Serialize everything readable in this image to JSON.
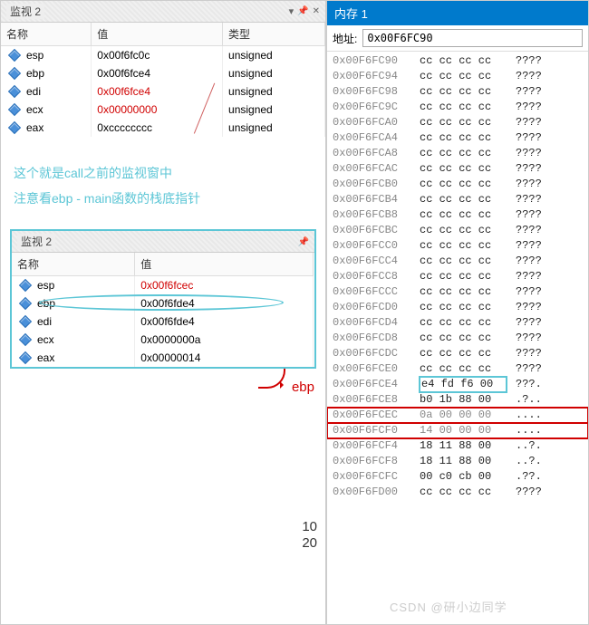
{
  "watch_top": {
    "title": "监视 2",
    "headers": {
      "name": "名称",
      "value": "值",
      "type": "类型"
    },
    "rows": [
      {
        "name": "esp",
        "value": "0x00f6fc0c",
        "type": "unsigned",
        "red": false
      },
      {
        "name": "ebp",
        "value": "0x00f6fce4",
        "type": "unsigned",
        "red": false
      },
      {
        "name": "edi",
        "value": "0x00f6fce4",
        "type": "unsigned",
        "red": true
      },
      {
        "name": "ecx",
        "value": "0x00000000",
        "type": "unsigned",
        "red": true
      },
      {
        "name": "eax",
        "value": "0xcccccccc",
        "type": "unsigned",
        "red": false
      }
    ]
  },
  "note": {
    "line1": "这个就是call之前的监视窗中",
    "line2": "注意看ebp - main函数的栈底指针"
  },
  "watch_sub": {
    "title": "监视 2",
    "headers": {
      "name": "名称",
      "value": "值"
    },
    "rows": [
      {
        "name": "esp",
        "value": "0x00f6fcec",
        "red": true
      },
      {
        "name": "ebp",
        "value": "0x00f6fde4",
        "red": false,
        "circled": true
      },
      {
        "name": "edi",
        "value": "0x00f6fde4",
        "red": false
      },
      {
        "name": "ecx",
        "value": "0x0000000a",
        "red": false
      },
      {
        "name": "eax",
        "value": "0x00000014",
        "red": false
      }
    ],
    "pointer_label": "ebp"
  },
  "annot": {
    "n1": "10",
    "n2": "20"
  },
  "memory": {
    "title": "内存 1",
    "addr_label": "地址:",
    "addr_value": "0x00F6FC90",
    "rows": [
      {
        "addr": "0x00F6FC90",
        "bytes": "cc cc cc cc",
        "ascii": "????"
      },
      {
        "addr": "0x00F6FC94",
        "bytes": "cc cc cc cc",
        "ascii": "????"
      },
      {
        "addr": "0x00F6FC98",
        "bytes": "cc cc cc cc",
        "ascii": "????"
      },
      {
        "addr": "0x00F6FC9C",
        "bytes": "cc cc cc cc",
        "ascii": "????"
      },
      {
        "addr": "0x00F6FCA0",
        "bytes": "cc cc cc cc",
        "ascii": "????"
      },
      {
        "addr": "0x00F6FCA4",
        "bytes": "cc cc cc cc",
        "ascii": "????"
      },
      {
        "addr": "0x00F6FCA8",
        "bytes": "cc cc cc cc",
        "ascii": "????"
      },
      {
        "addr": "0x00F6FCAC",
        "bytes": "cc cc cc cc",
        "ascii": "????"
      },
      {
        "addr": "0x00F6FCB0",
        "bytes": "cc cc cc cc",
        "ascii": "????"
      },
      {
        "addr": "0x00F6FCB4",
        "bytes": "cc cc cc cc",
        "ascii": "????"
      },
      {
        "addr": "0x00F6FCB8",
        "bytes": "cc cc cc cc",
        "ascii": "????"
      },
      {
        "addr": "0x00F6FCBC",
        "bytes": "cc cc cc cc",
        "ascii": "????"
      },
      {
        "addr": "0x00F6FCC0",
        "bytes": "cc cc cc cc",
        "ascii": "????"
      },
      {
        "addr": "0x00F6FCC4",
        "bytes": "cc cc cc cc",
        "ascii": "????"
      },
      {
        "addr": "0x00F6FCC8",
        "bytes": "cc cc cc cc",
        "ascii": "????"
      },
      {
        "addr": "0x00F6FCCC",
        "bytes": "cc cc cc cc",
        "ascii": "????"
      },
      {
        "addr": "0x00F6FCD0",
        "bytes": "cc cc cc cc",
        "ascii": "????"
      },
      {
        "addr": "0x00F6FCD4",
        "bytes": "cc cc cc cc",
        "ascii": "????"
      },
      {
        "addr": "0x00F6FCD8",
        "bytes": "cc cc cc cc",
        "ascii": "????"
      },
      {
        "addr": "0x00F6FCDC",
        "bytes": "cc cc cc cc",
        "ascii": "????"
      },
      {
        "addr": "0x00F6FCE0",
        "bytes": "cc cc cc cc",
        "ascii": "????"
      },
      {
        "addr": "0x00F6FCE4",
        "bytes": "e4 fd f6 00",
        "ascii": "???.",
        "hl": "blue"
      },
      {
        "addr": "0x00F6FCE8",
        "bytes": "b0 1b 88 00",
        "ascii": ".?.."
      },
      {
        "addr": "0x00F6FCEC",
        "bytes": "0a 00 00 00",
        "ascii": "....",
        "hl": "red"
      },
      {
        "addr": "0x00F6FCF0",
        "bytes": "14 00 00 00",
        "ascii": "....",
        "hl": "red"
      },
      {
        "addr": "0x00F6FCF4",
        "bytes": "18 11 88 00",
        "ascii": "..?."
      },
      {
        "addr": "0x00F6FCF8",
        "bytes": "18 11 88 00",
        "ascii": "..?."
      },
      {
        "addr": "0x00F6FCFC",
        "bytes": "00 c0 cb 00",
        "ascii": ".??."
      },
      {
        "addr": "0x00F6FD00",
        "bytes": "cc cc cc cc",
        "ascii": "????"
      }
    ]
  },
  "watermark": "CSDN @研小边同学"
}
